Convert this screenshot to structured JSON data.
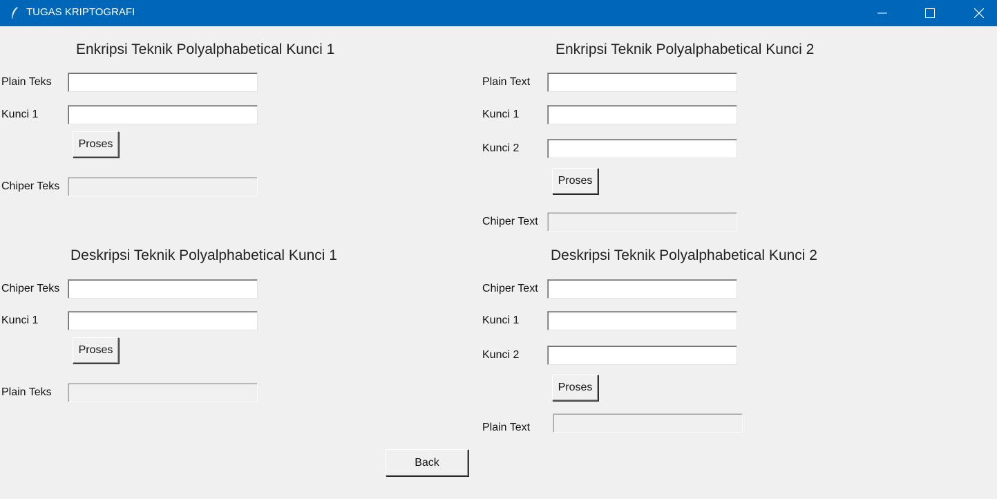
{
  "window": {
    "title": "TUGAS KRIPTOGRAFI",
    "icon": "feather-icon",
    "controls": [
      "minimize-icon",
      "maximize-icon",
      "close-icon"
    ]
  },
  "enc1": {
    "heading": "Enkripsi Teknik Polyalphabetical Kunci 1",
    "plain_label": "Plain Teks",
    "key1_label": "Kunci 1",
    "button": "Proses",
    "cipher_label": "Chiper Teks",
    "plain_value": "",
    "key1_value": "",
    "cipher_value": ""
  },
  "enc2": {
    "heading": "Enkripsi Teknik Polyalphabetical Kunci 2",
    "plain_label": "Plain Text",
    "key1_label": "Kunci 1",
    "key2_label": "Kunci 2",
    "button": "Proses",
    "cipher_label": "Chiper Text",
    "plain_value": "",
    "key1_value": "",
    "key2_value": "",
    "cipher_value": ""
  },
  "dec1": {
    "heading": "Deskripsi Teknik Polyalphabetical Kunci 1",
    "cipher_label": "Chiper Teks",
    "key1_label": "Kunci 1",
    "button": "Proses",
    "plain_label": "Plain Teks",
    "cipher_value": "",
    "key1_value": "",
    "plain_value": ""
  },
  "dec2": {
    "heading": "Deskripsi Teknik Polyalphabetical Kunci 2",
    "cipher_label": "Chiper Text",
    "key1_label": "Kunci 1",
    "key2_label": "Kunci 2",
    "button": "Proses",
    "plain_label": "Plain Text",
    "cipher_value": "",
    "key1_value": "",
    "key2_value": "",
    "plain_value": ""
  },
  "footer": {
    "back_label": "Back"
  },
  "colors": {
    "titlebar": "#0067b8",
    "background": "#f0f0f0"
  }
}
